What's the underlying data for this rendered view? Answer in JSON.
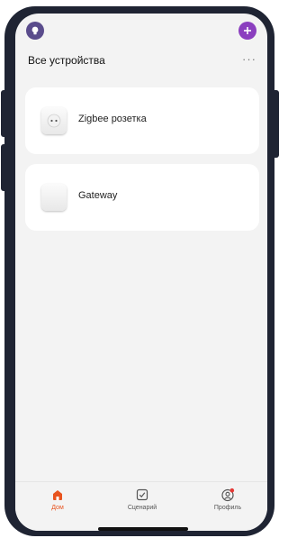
{
  "header": {
    "title": "Все устройства",
    "more_label": "···"
  },
  "devices": [
    {
      "name": "Zigbee розетка",
      "icon": "power-socket-icon"
    },
    {
      "name": "Gateway",
      "icon": "gateway-icon"
    }
  ],
  "tabbar": {
    "tabs": [
      {
        "label": "Дом",
        "icon": "home-icon",
        "active": true
      },
      {
        "label": "Сценарий",
        "icon": "scene-checkbox-icon",
        "active": false
      },
      {
        "label": "Профиль",
        "icon": "profile-icon",
        "active": false,
        "badge": true
      }
    ]
  },
  "colors": {
    "accent": "#e8541f",
    "add_button": "#8b3fbf",
    "home_avatar": "#5a4c8c",
    "badge": "#e53935",
    "frame": "#1f2433",
    "background": "#f3f3f3"
  }
}
